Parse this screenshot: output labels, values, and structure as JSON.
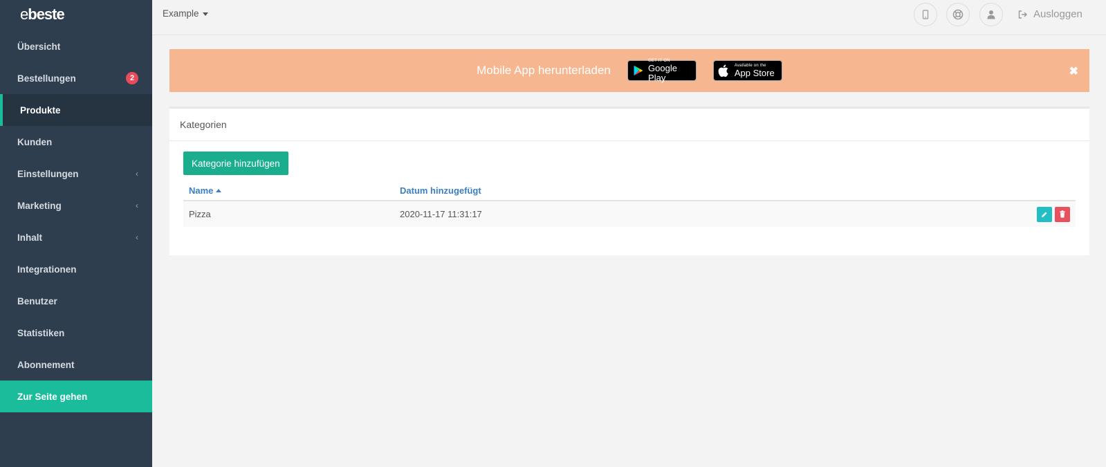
{
  "brand": {
    "logo_e": "e",
    "logo_rest": "beste"
  },
  "sidebar": {
    "items": [
      {
        "label": "Übersicht"
      },
      {
        "label": "Bestellungen",
        "badge": "2"
      },
      {
        "label": "Produkte",
        "active": true
      },
      {
        "label": "Kunden"
      },
      {
        "label": "Einstellungen",
        "chevron": "‹"
      },
      {
        "label": "Marketing",
        "chevron": "‹"
      },
      {
        "label": "Inhalt",
        "chevron": "‹"
      },
      {
        "label": "Integrationen"
      },
      {
        "label": "Benutzer"
      },
      {
        "label": "Statistiken"
      },
      {
        "label": "Abonnement"
      },
      {
        "label": "Zur Seite gehen"
      }
    ]
  },
  "topbar": {
    "site_label": "Example",
    "logout_label": "Ausloggen",
    "icons": [
      "mobile-icon",
      "support-icon",
      "user-icon",
      "logout-icon"
    ]
  },
  "banner": {
    "text": "Mobile App herunterladen",
    "google_small": "GET IT ON",
    "google_big": "Google Play",
    "apple_small": "Available on the",
    "apple_big": "App Store",
    "close": "✖"
  },
  "panel": {
    "title": "Kategorien",
    "add_button": "Kategorie hinzufügen",
    "columns": {
      "name": "Name",
      "date": "Datum hinzugefügt"
    },
    "rows": [
      {
        "name": "Pizza",
        "date": "2020-11-17 11:31:17"
      }
    ]
  },
  "colors": {
    "sidebar_bg": "#2f3e4e",
    "accent": "#1abc9c",
    "banner_bg": "#f5b690",
    "link": "#3a7fc0",
    "danger": "#e8505e",
    "info": "#23bdc4"
  }
}
